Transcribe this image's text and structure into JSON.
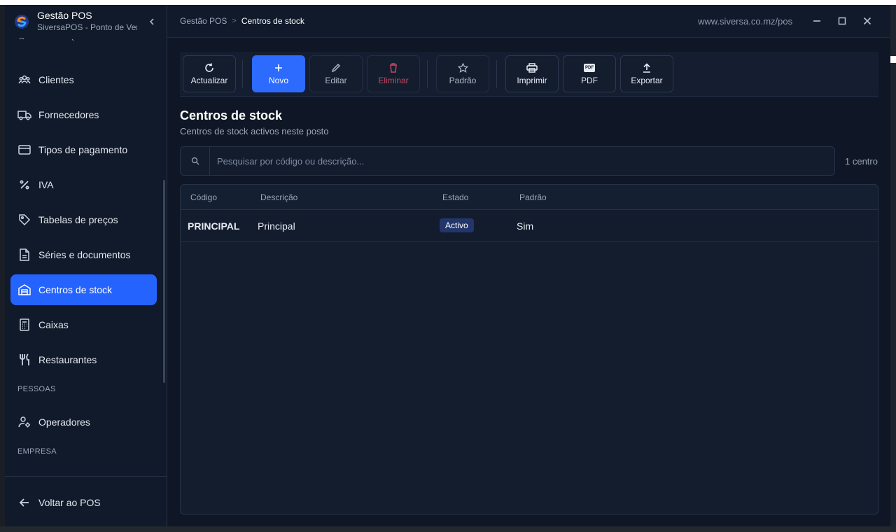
{
  "app": {
    "title": "Gestão POS",
    "subtitle": "SiversaPOS - Ponto de Venda",
    "url": "www.siversa.co.mz/pos"
  },
  "breadcrumb": {
    "root": "Gestão POS",
    "separator": ">",
    "current": "Centros de stock"
  },
  "sidebar": {
    "items": [
      {
        "label": "Clientes",
        "icon": "users-icon"
      },
      {
        "label": "Fornecedores",
        "icon": "truck-icon"
      },
      {
        "label": "Tipos de pagamento",
        "icon": "credit-card-icon"
      },
      {
        "label": "IVA",
        "icon": "percent-icon"
      },
      {
        "label": "Tabelas de preços",
        "icon": "tag-icon"
      },
      {
        "label": "Séries e documentos",
        "icon": "document-icon"
      },
      {
        "label": "Centros de stock",
        "icon": "warehouse-icon",
        "active": true
      },
      {
        "label": "Caixas",
        "icon": "cash-register-icon"
      },
      {
        "label": "Restaurantes",
        "icon": "utensils-icon"
      }
    ],
    "section_people": "PESSOAS",
    "people_items": [
      {
        "label": "Operadores",
        "icon": "user-gear-icon"
      }
    ],
    "section_company": "EMPRESA",
    "back_label": "Voltar ao POS"
  },
  "toolbar": {
    "refresh": "Actualizar",
    "new": "Novo",
    "edit": "Editar",
    "delete": "Eliminar",
    "default": "Padrão",
    "print": "Imprimir",
    "pdf": "PDF",
    "pdf_badge": "PDF",
    "export": "Exportar"
  },
  "page": {
    "title": "Centros de stock",
    "subtitle": "Centros de stock activos neste posto"
  },
  "search": {
    "placeholder": "Pesquisar por código ou descrição...",
    "value": ""
  },
  "count_label": "1 centro",
  "table": {
    "columns": [
      "Código",
      "Descrição",
      "Estado",
      "Padrão"
    ],
    "rows": [
      {
        "code": "PRINCIPAL",
        "description": "Principal",
        "status": "Activo",
        "default": "Sim"
      }
    ]
  },
  "colors": {
    "accent": "#2563ff",
    "background": "#0f1726",
    "danger": "#c44760",
    "badge": "#23366b"
  }
}
